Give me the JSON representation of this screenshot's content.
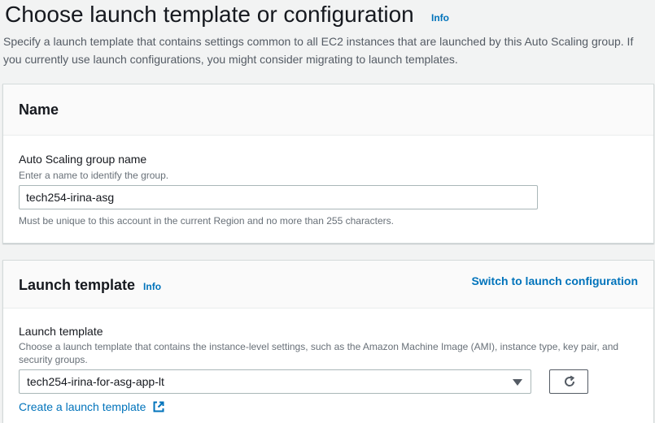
{
  "header": {
    "title": "Choose launch template or configuration",
    "info_label": "Info",
    "description": "Specify a launch template that contains settings common to all EC2 instances that are launched by this Auto Scaling group. If you currently use launch configurations, you might consider migrating to launch templates."
  },
  "name_panel": {
    "title": "Name",
    "field_label": "Auto Scaling group name",
    "field_description": "Enter a name to identify the group.",
    "input_value": "tech254-irina-asg",
    "constraint_text": "Must be unique to this account in the current Region and no more than 255 characters."
  },
  "launch_panel": {
    "title": "Launch template",
    "info_label": "Info",
    "switch_link": "Switch to launch configuration",
    "field_label": "Launch template",
    "field_description": "Choose a launch template that contains the instance-level settings, such as the Amazon Machine Image (AMI), instance type, key pair, and security groups.",
    "selected_template": "tech254-irina-for-asg-app-lt",
    "create_link": "Create a launch template"
  },
  "icons": {
    "refresh": "refresh-icon",
    "external": "external-link-icon",
    "caret": "caret-down-icon"
  },
  "colors": {
    "link": "#0073bb",
    "background": "#f2f3f3",
    "panel_header": "#fafafa"
  }
}
